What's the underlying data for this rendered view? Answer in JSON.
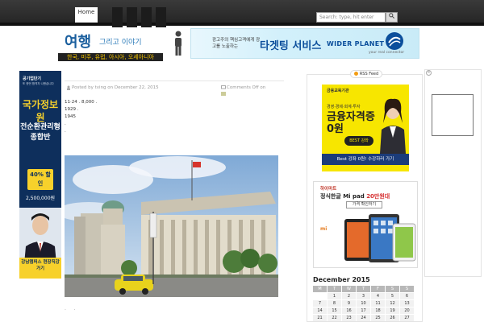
{
  "nav": {
    "home_label": "Home",
    "search_placeholder": "Search: type, hit enter",
    "search_button": "🔍"
  },
  "header": {
    "logo_main": "여행",
    "logo_sub": "그리고 이야기",
    "logo_tagline": "한국, 미주, 유럽, 아시아, 오세아니아"
  },
  "top_ad": {
    "text_small": "광고주의 핵심고객에게 광고를 노출하는",
    "headline": "타겟팅 서비스",
    "brand": "WIDER PLANET",
    "sub": "your real connector"
  },
  "left_ad": {
    "brand": "공기업단기",
    "small": "또 한번 합격자 나왔습니다",
    "title1": "국가정보원",
    "title2": "전순환관리형종합반",
    "discount": "40% 할인",
    "price": "2,500,000원",
    "footer": "강남캠퍼스 현장직강 가기"
  },
  "post": {
    "meta_author": "Posted by tving on December 22, 2015",
    "meta_comments": "Comments Off on",
    "text_lines": [
      "11·24 .        8,000  .",
      "            1929  .",
      "            1945",
      ".",
      "."
    ]
  },
  "sidebar": {
    "rss_label": "RSS Feed",
    "ad1": {
      "top": "금융교육기관",
      "kicker": "경영·경제·회계·투자",
      "title": "금융자격증 0원",
      "badge": "BEST 강좌",
      "bottom": "Best 강좌 0원! 수강하러 가기"
    },
    "ad2": {
      "brand": "하이마트",
      "title_prefix": "정식한글 Mi pad",
      "title_highlight": "20만원대",
      "button": "가격 확인하기",
      "mi_logo": "mi"
    }
  },
  "calendar": {
    "title": "December 2015",
    "headers": [
      "M",
      "T",
      "W",
      "T",
      "F",
      "S",
      "S"
    ],
    "rows": [
      [
        "",
        "1",
        "2",
        "3",
        "4",
        "5",
        "6"
      ],
      [
        "7",
        "8",
        "9",
        "10",
        "11",
        "12",
        "13"
      ],
      [
        "14",
        "15",
        "16",
        "17",
        "18",
        "19",
        "20"
      ],
      [
        "21",
        "22",
        "23",
        "24",
        "25",
        "26",
        "27"
      ]
    ]
  },
  "colors": {
    "topbar": "#2c2c2c",
    "logo_blue": "#1b5f9e",
    "ad_navy": "#0e2f5c",
    "ad_yellow": "#f7e600"
  }
}
